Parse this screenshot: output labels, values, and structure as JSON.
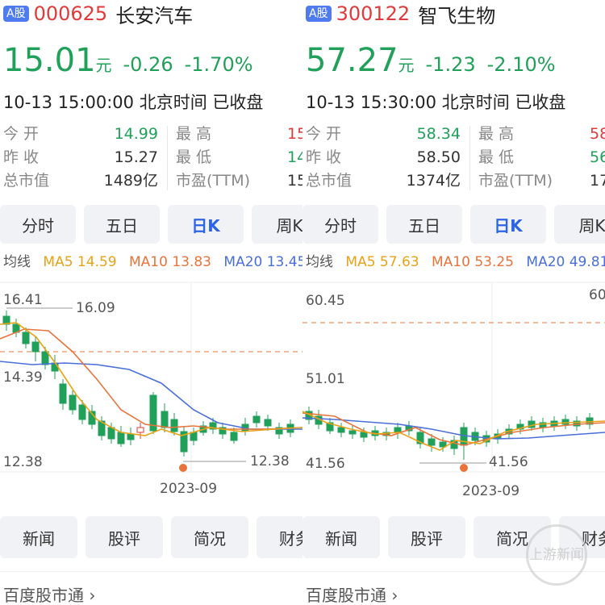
{
  "panels": [
    {
      "badge": "A股",
      "code": "000625",
      "name": "长安汽车",
      "price": "15.01",
      "unit": "元",
      "change": "-0.26",
      "change_pct": "-1.70%",
      "time": "10-13 15:00:00",
      "tz": "北京时间",
      "status": "已收盘",
      "stats_left": [
        {
          "label": "今  开",
          "value": "14.99"
        },
        {
          "label": "昨  收",
          "value": "15.27"
        },
        {
          "label": "总市值",
          "value": "1489亿"
        }
      ],
      "stats_right": [
        {
          "label": "最  高",
          "value": "15"
        },
        {
          "label": "最  低",
          "value": "14"
        },
        {
          "label": "市盈(TTM)",
          "value": "15"
        }
      ],
      "tabs": [
        "分时",
        "五日",
        "日K",
        "周K"
      ],
      "active_tab": "日K",
      "ma": {
        "label": "均线",
        "ma5": "MA5 14.59",
        "ma10": "MA10 13.83",
        "ma20": "MA20 13.45"
      },
      "chart": {
        "y_labels": [
          "16.41",
          "14.39",
          "12.38"
        ],
        "high_mark": "16.09",
        "low_mark": "12.38",
        "x_label": "2023-09"
      },
      "bottom_tabs": [
        "新闻",
        "股评",
        "简况",
        "财务"
      ],
      "footer": "百度股市通 ›"
    },
    {
      "badge": "A股",
      "code": "300122",
      "name": "智飞生物",
      "price": "57.27",
      "unit": "元",
      "change": "-1.23",
      "change_pct": "-2.10%",
      "time": "10-13 15:30:00",
      "tz": "北京时间",
      "status": "已收盘",
      "stats_left": [
        {
          "label": "今  开",
          "value": "58.34"
        },
        {
          "label": "昨  收",
          "value": "58.50"
        },
        {
          "label": "总市值",
          "value": "1374亿"
        }
      ],
      "stats_right": [
        {
          "label": "最  高",
          "value": "58"
        },
        {
          "label": "最  低",
          "value": "56"
        },
        {
          "label": "市盈(TTM)",
          "value": "17"
        }
      ],
      "tabs": [
        "分时",
        "五日",
        "日K",
        "周K"
      ],
      "active_tab": "日K",
      "ma": {
        "label": "均线",
        "ma5": "MA5 57.63",
        "ma10": "MA10 53.25",
        "ma20": "MA20 49.81"
      },
      "chart": {
        "y_labels": [
          "60.45",
          "51.01",
          "41.56"
        ],
        "high_mark": "60",
        "low_mark": "41.56",
        "x_label": "2023-09"
      },
      "bottom_tabs": [
        "新闻",
        "股评",
        "简况",
        "财务"
      ],
      "footer": "百度股市通 ›"
    }
  ],
  "watermark": "上游新闻",
  "colors": {
    "up": "#e03a3a",
    "down": "#21a05a",
    "accent": "#2d64e6",
    "ma5": "#e8a317",
    "ma10": "#e8743b",
    "ma20": "#4a6fd8"
  }
}
